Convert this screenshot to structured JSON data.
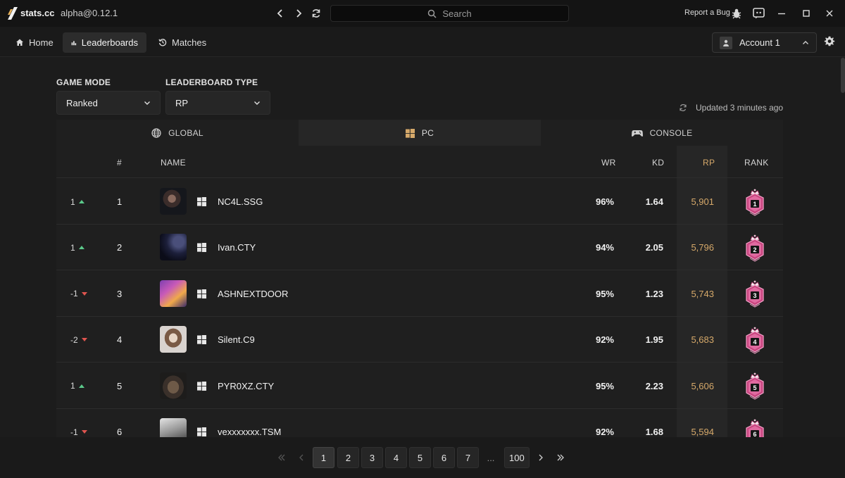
{
  "app": {
    "name": "stats.cc",
    "version": "alpha@0.12.1"
  },
  "search": {
    "placeholder": "Search"
  },
  "titlebar": {
    "report_bug": "Report a Bug"
  },
  "nav": {
    "tabs": [
      {
        "label": "Home"
      },
      {
        "label": "Leaderboards"
      },
      {
        "label": "Matches"
      }
    ]
  },
  "account": {
    "label": "Account 1"
  },
  "filters": {
    "game_mode_label": "GAME MODE",
    "game_mode_value": "Ranked",
    "leaderboard_type_label": "LEADERBOARD TYPE",
    "leaderboard_type_value": "RP"
  },
  "updated": "Updated 3 minutes ago",
  "regions": [
    {
      "label": "GLOBAL"
    },
    {
      "label": "PC"
    },
    {
      "label": "CONSOLE"
    }
  ],
  "table": {
    "headers": {
      "position": "#",
      "name": "NAME",
      "wr": "WR",
      "kd": "KD",
      "rp": "RP",
      "rank": "RANK"
    },
    "rows": [
      {
        "change": "1",
        "dir": "up",
        "position": "1",
        "name": "NC4L.SSG",
        "wr": "96%",
        "kd": "1.64",
        "rp": "5,901",
        "rank": "1"
      },
      {
        "change": "1",
        "dir": "up",
        "position": "2",
        "name": "Ivan.CTY",
        "wr": "94%",
        "kd": "2.05",
        "rp": "5,796",
        "rank": "2"
      },
      {
        "change": "-1",
        "dir": "down",
        "position": "3",
        "name": "ASHNEXTDOOR",
        "wr": "95%",
        "kd": "1.23",
        "rp": "5,743",
        "rank": "3"
      },
      {
        "change": "-2",
        "dir": "down",
        "position": "4",
        "name": "Silent.C9",
        "wr": "92%",
        "kd": "1.95",
        "rp": "5,683",
        "rank": "4"
      },
      {
        "change": "1",
        "dir": "up",
        "position": "5",
        "name": "PYR0XZ.CTY",
        "wr": "95%",
        "kd": "2.23",
        "rp": "5,606",
        "rank": "5"
      },
      {
        "change": "-1",
        "dir": "down",
        "position": "6",
        "name": "vexxxxxxx.TSM",
        "wr": "92%",
        "kd": "1.68",
        "rp": "5,594",
        "rank": "6"
      }
    ]
  },
  "pagination": {
    "pages": [
      "1",
      "2",
      "3",
      "4",
      "5",
      "6",
      "7"
    ],
    "ellipsis": "...",
    "last": "100",
    "current": "1"
  },
  "colors": {
    "rp": "#d6a96a",
    "up": "#5bc98a",
    "down": "#e0554f",
    "rank_badge": "#c8457f"
  }
}
